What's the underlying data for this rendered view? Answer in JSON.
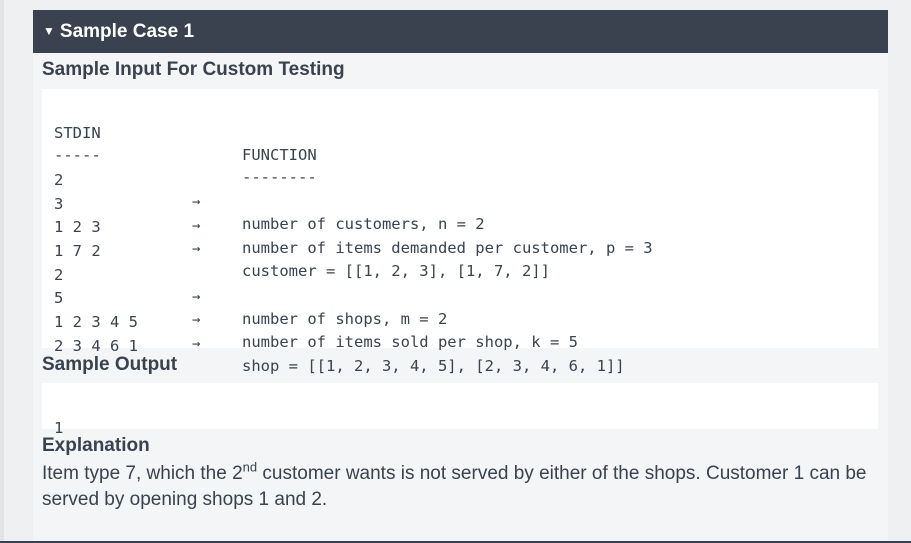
{
  "sample_case": {
    "title": "Sample Case 1"
  },
  "sample_input": {
    "heading": "Sample Input For Custom Testing",
    "stdin_header": "STDIN",
    "function_header": "FUNCTION",
    "stdin_divider": "-----",
    "function_divider": "--------",
    "rows": [
      {
        "stdin": "2",
        "arrow": "→",
        "function": "number of customers, n = 2"
      },
      {
        "stdin": "3",
        "arrow": "→",
        "function": "number of items demanded per customer, p = 3"
      },
      {
        "stdin": "1 2 3",
        "arrow": "→",
        "function": "customer = [[1, 2, 3], [1, 7, 2]]"
      },
      {
        "stdin": "1 7 2",
        "arrow": "",
        "function": ""
      },
      {
        "stdin": "2",
        "arrow": "→",
        "function": "number of shops, m = 2"
      },
      {
        "stdin": "5",
        "arrow": "→",
        "function": "number of items sold per shop, k = 5"
      },
      {
        "stdin": "1 2 3 4 5",
        "arrow": "→",
        "function": "shop = [[1, 2, 3, 4, 5], [2, 3, 4, 6, 1]]"
      },
      {
        "stdin": "2 3 4 6 1",
        "arrow": "",
        "function": ""
      }
    ]
  },
  "sample_output": {
    "heading": "Sample Output",
    "value": "1"
  },
  "explanation": {
    "heading": "Explanation",
    "text_before": "Item type 7, which the 2",
    "superscript": "nd",
    "text_after": " customer wants is not served by either of the shops. Customer 1 can be served by opening shops 1 and 2."
  }
}
